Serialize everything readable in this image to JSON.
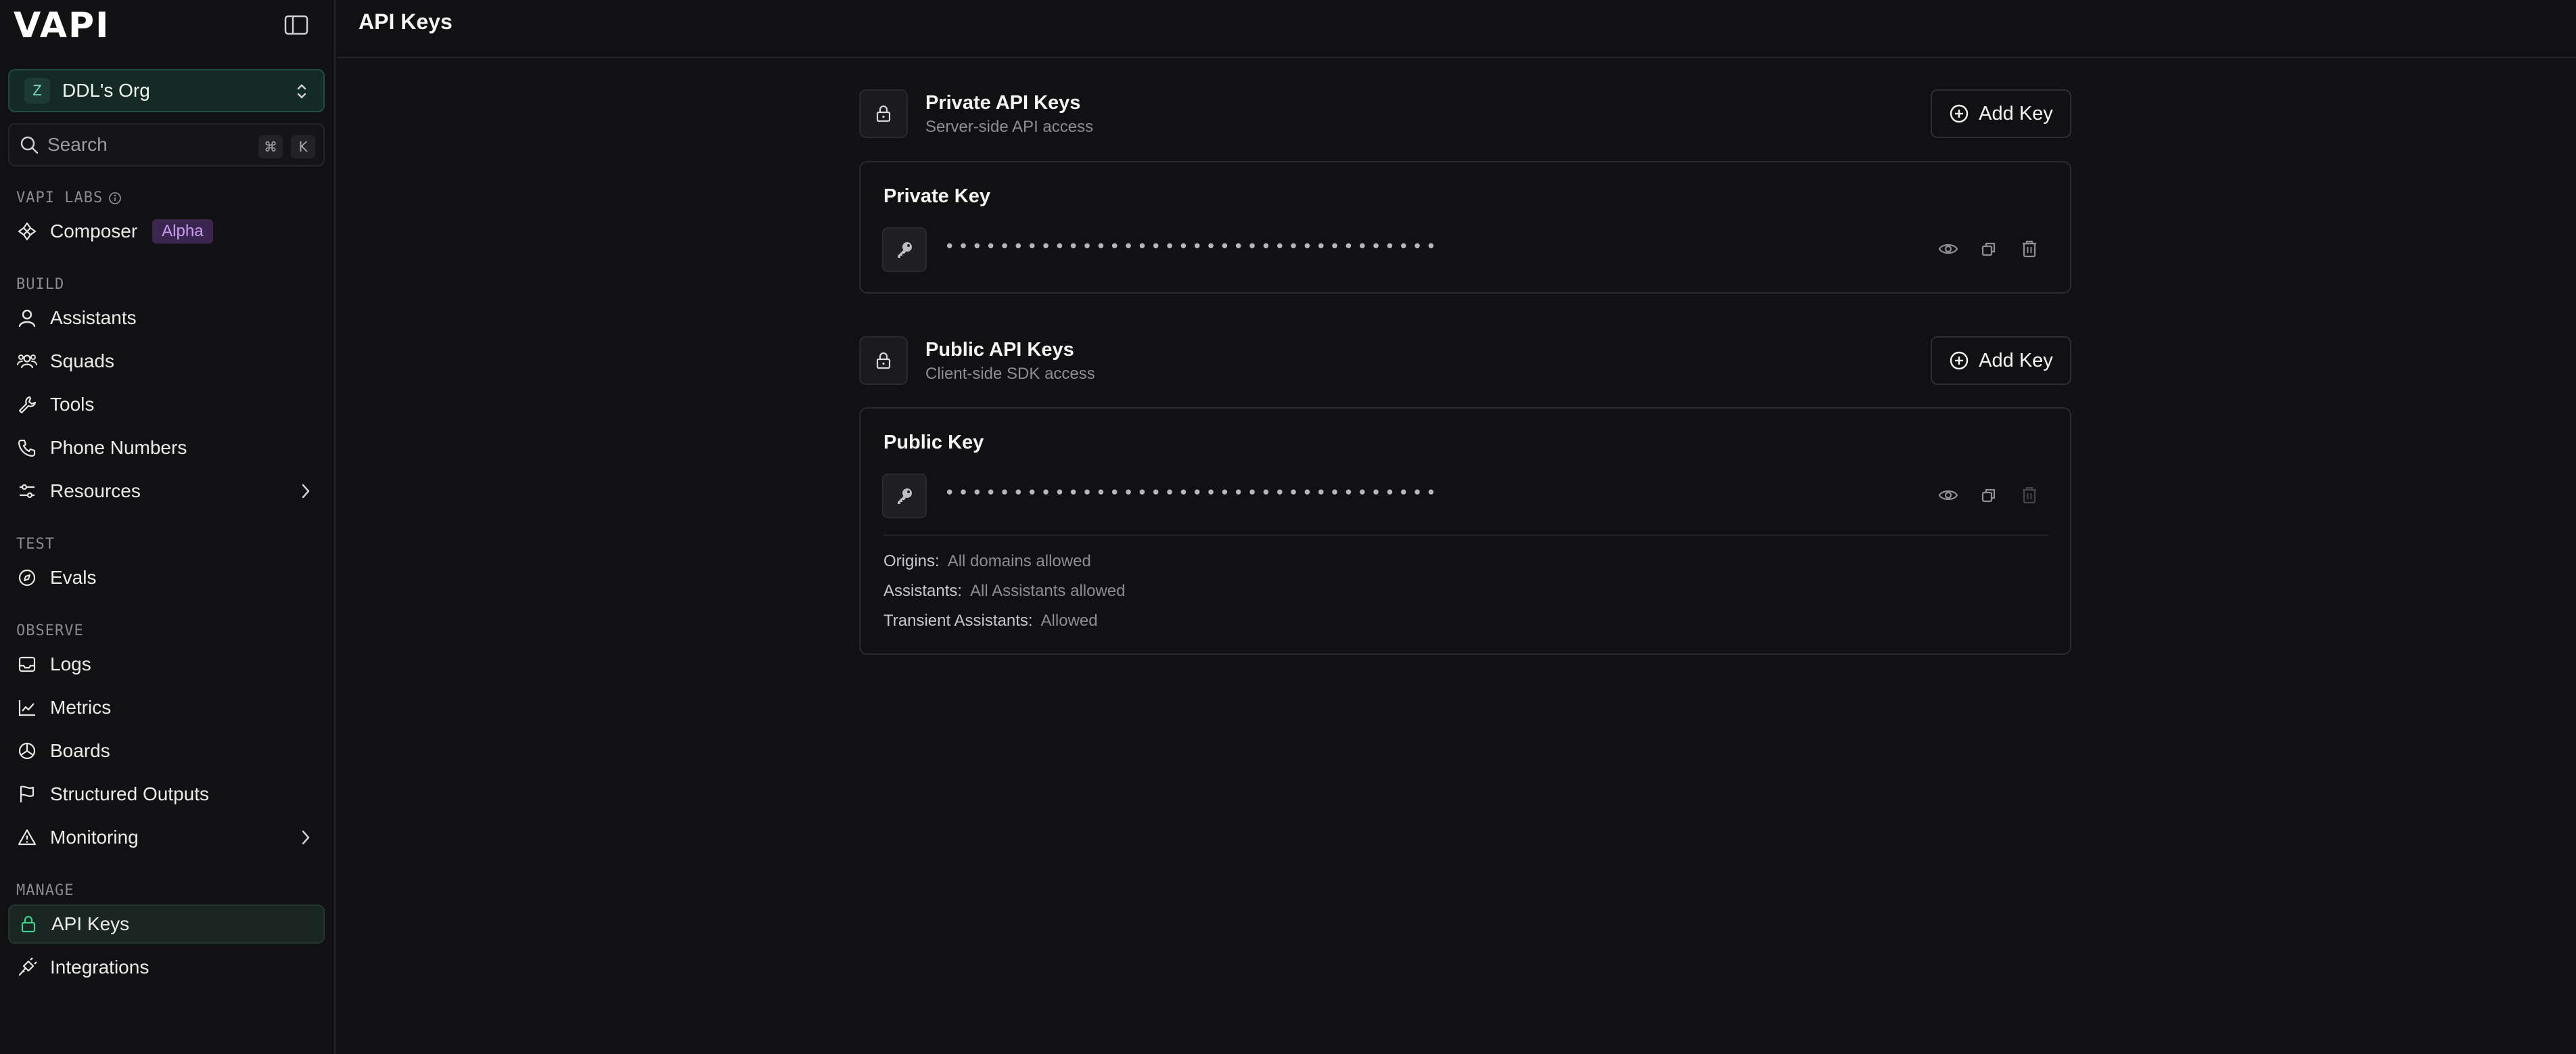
{
  "sidebar": {
    "logo": "VAPI",
    "org": {
      "avatar": "Z",
      "name": "DDL's Org"
    },
    "search": {
      "placeholder": "Search",
      "shortcut_cmd": "⌘",
      "shortcut_key": "K"
    },
    "sections": {
      "labs": "VAPI LABS",
      "build": "BUILD",
      "test": "TEST",
      "observe": "OBSERVE",
      "manage": "MANAGE"
    },
    "items": {
      "composer": "Composer",
      "composer_badge": "Alpha",
      "assistants": "Assistants",
      "squads": "Squads",
      "tools": "Tools",
      "phone_numbers": "Phone Numbers",
      "resources": "Resources",
      "evals": "Evals",
      "logs": "Logs",
      "metrics": "Metrics",
      "boards": "Boards",
      "structured_outputs": "Structured Outputs",
      "monitoring": "Monitoring",
      "api_keys": "API Keys",
      "integrations": "Integrations"
    },
    "active_item": "api_keys"
  },
  "header": {
    "title": "API Keys"
  },
  "private_section": {
    "title": "Private API Keys",
    "subtitle": "Server-side API access",
    "add_label": "Add Key",
    "card": {
      "title": "Private Key",
      "masked_value": "••••••••••••••••••••••••••••••••••••"
    }
  },
  "public_section": {
    "title": "Public API Keys",
    "subtitle": "Client-side SDK access",
    "add_label": "Add Key",
    "card": {
      "title": "Public Key",
      "masked_value": "••••••••••••••••••••••••••••••••••••",
      "origins_label": "Origins:",
      "origins_value": "All domains allowed",
      "assistants_label": "Assistants:",
      "assistants_value": "All Assistants allowed",
      "transient_label": "Transient Assistants:",
      "transient_value": "Allowed"
    }
  },
  "colors": {
    "background": "#111113",
    "accent": "#3ecf8e",
    "badge_bg": "#3b2650",
    "badge_text": "#c99cf2"
  }
}
